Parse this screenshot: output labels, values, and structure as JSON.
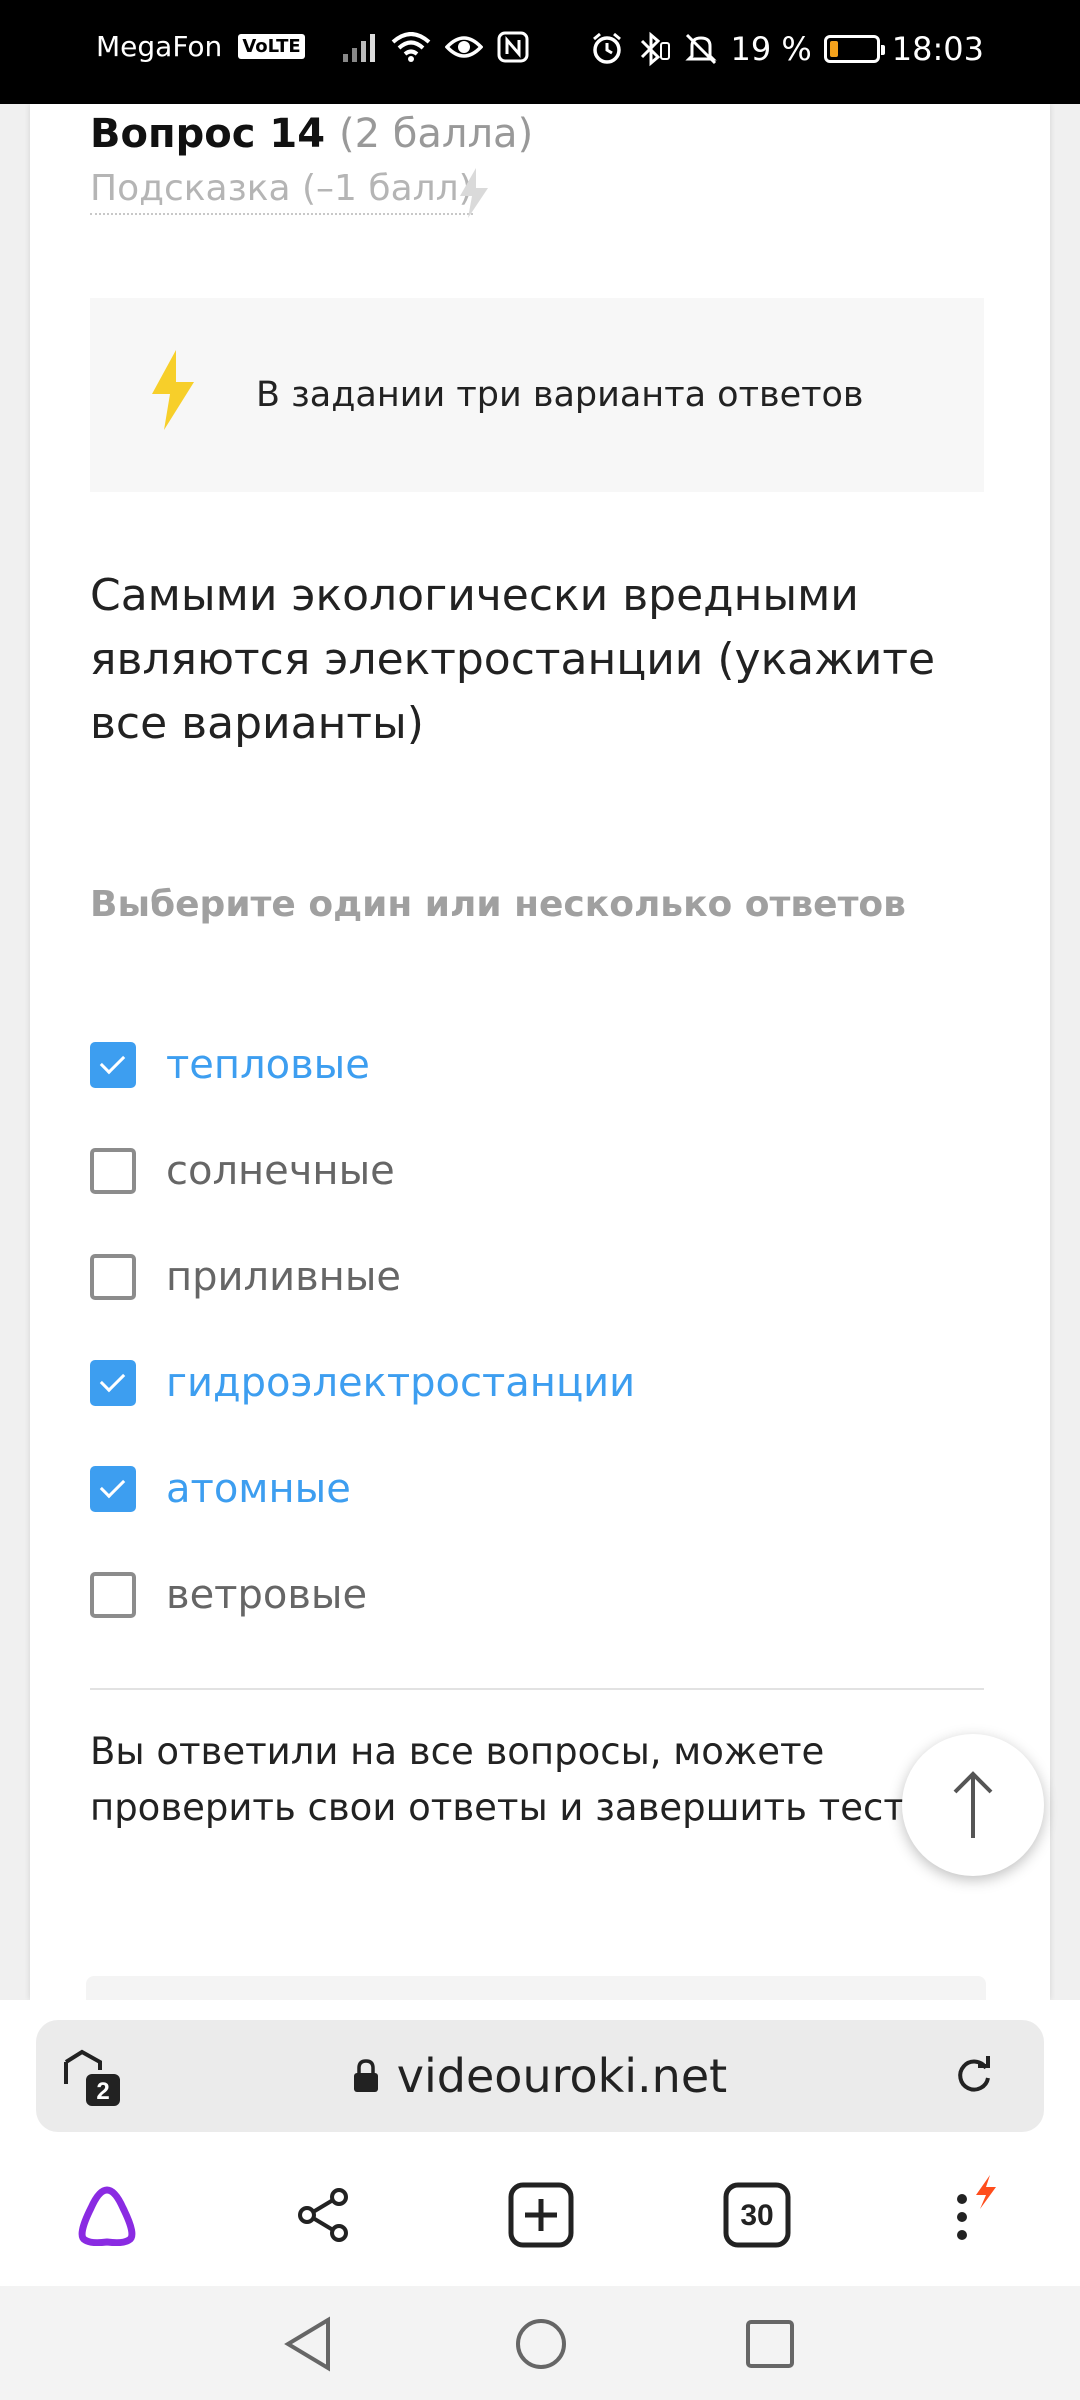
{
  "status_bar": {
    "carrier": "MegaFon",
    "volte": "VoLTE",
    "battery_percent": "19 %",
    "battery_level": 0.19,
    "time": "18:03",
    "icons": [
      "signal-icon",
      "wifi-icon",
      "eye-icon",
      "nfc-icon",
      "alarm-icon",
      "bluetooth-icon",
      "mute-icon",
      "battery-icon"
    ]
  },
  "question": {
    "number_label": "Вопрос 14",
    "points": "(2 балла)",
    "hint_link": "Подсказка (–1 балл)",
    "note": "В задании три варианта ответов",
    "text": "Самыми экологически вредными являются электростанции (укажите все варианты)",
    "select_hint": "Выберите один или несколько ответов",
    "options": [
      {
        "label": "тепловые",
        "checked": true
      },
      {
        "label": "солнечные",
        "checked": false
      },
      {
        "label": "приливные",
        "checked": false
      },
      {
        "label": "гидроэлектростанции",
        "checked": true
      },
      {
        "label": "атомные",
        "checked": true
      },
      {
        "label": "ветровые",
        "checked": false
      }
    ]
  },
  "completion_text": "Вы ответили на все вопросы, можете проверить свои ответы и завершить тест",
  "browser": {
    "tabs_count": "2",
    "url": "videouroki.net",
    "tab_counter": "30"
  },
  "colors": {
    "accent": "#3d9ef0",
    "bolt": "#f7cf2a",
    "alice": "#8a2be2",
    "menu_badge": "#ff4d1c"
  }
}
